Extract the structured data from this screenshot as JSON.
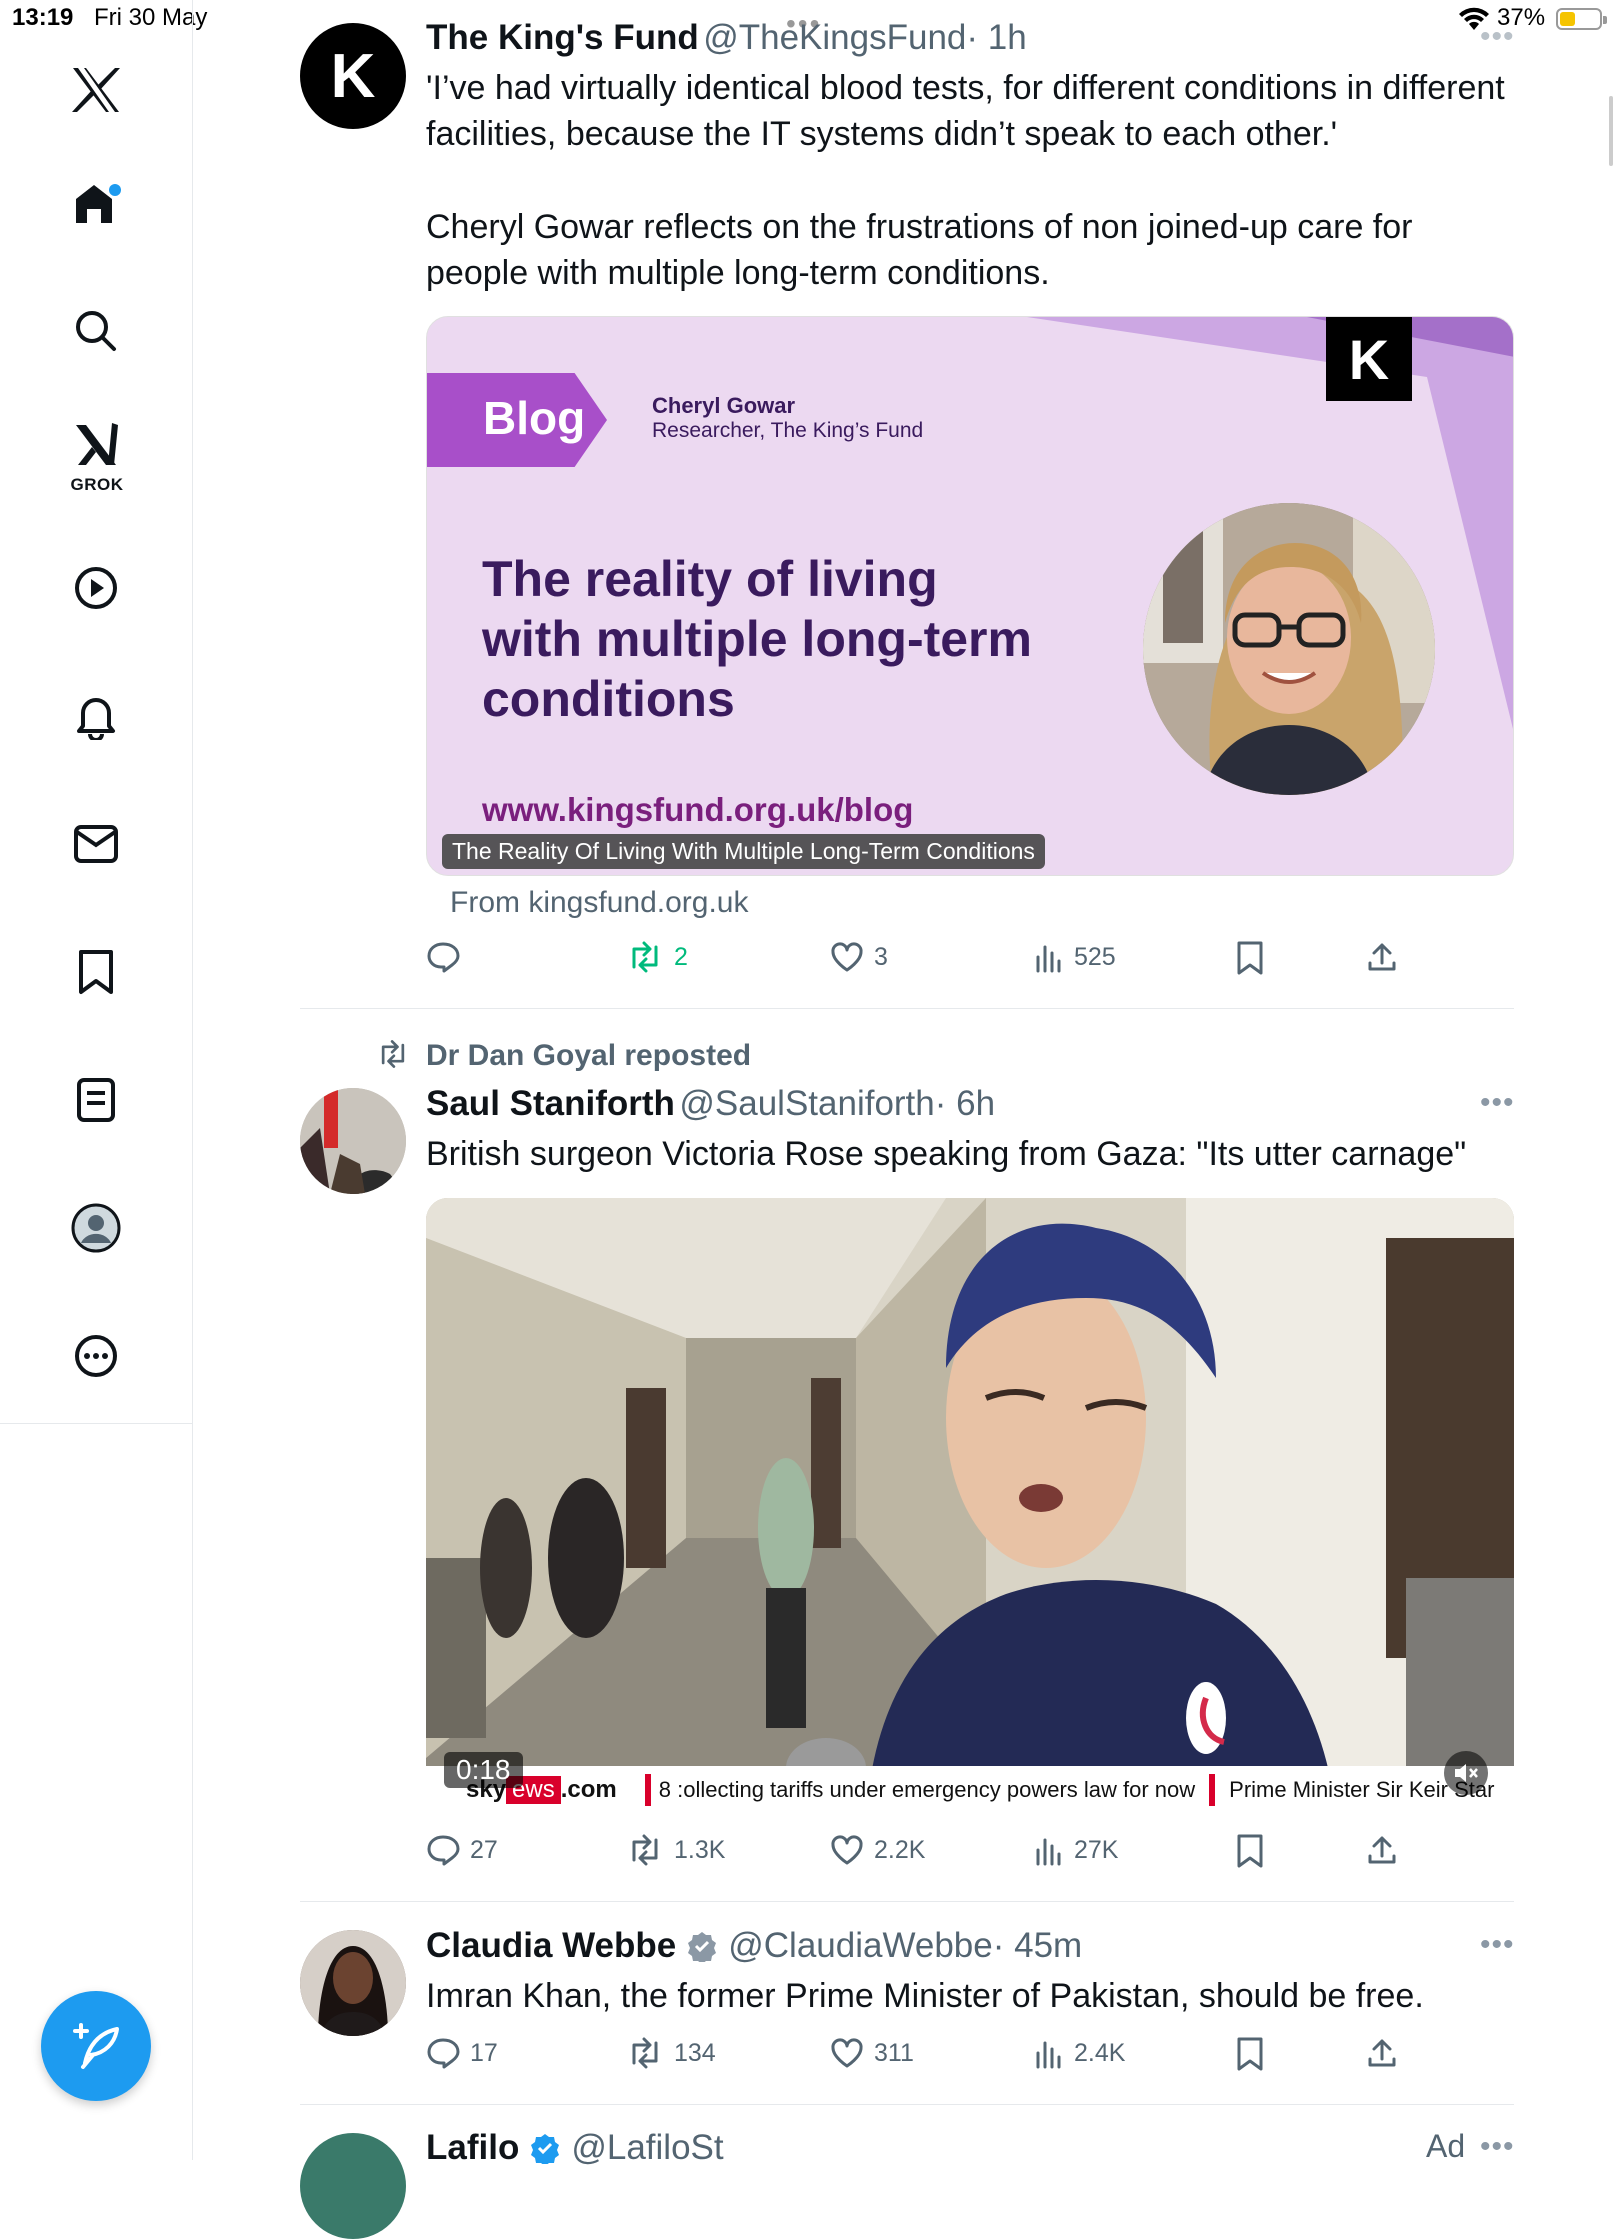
{
  "status_bar": {
    "time": "13:19",
    "date": "Fri 30 May",
    "battery": "37%"
  },
  "sidebar": {
    "grok_label": "GROK"
  },
  "tweets": [
    {
      "name": "The King's Fund",
      "handle": "@TheKingsFund",
      "time": "· 1h",
      "text1": "'I’ve had virtually identical blood tests, for different conditions in different facilities, because the IT systems didn’t speak to each other.'",
      "text2": "Cheryl Gowar reflects on the frustrations of non joined-up care for people with multiple long-term conditions.",
      "card": {
        "tag": "Blog",
        "author": "Cheryl Gowar",
        "author_role": "Researcher, The King’s Fund",
        "headline_1": "The reality of living",
        "headline_2": "with multiple long-term",
        "headline_3": "conditions",
        "url": "www.kingsfund.org.uk/blog",
        "logo": "K",
        "caption": "The Reality Of Living With Multiple Long-Term Conditions",
        "from": "From kingsfund.org.uk"
      },
      "stats": {
        "replies": "",
        "reposts": "2",
        "likes": "3",
        "views": "525"
      },
      "avatar_letter": "K"
    },
    {
      "repost_by": "Dr Dan Goyal reposted",
      "name": "Saul Staniforth",
      "handle": "@SaulStaniforth",
      "time": "· 6h",
      "text": "British surgeon Victoria Rose speaking from Gaza: \"Its utter carnage\"",
      "video": {
        "duration": "0:18",
        "ticker_brand": "sky",
        "ticker_news": "ews",
        "ticker_com": ".com",
        "ticker_text1": "8 :ollecting tariffs under emergency powers law for now",
        "ticker_text2": "Prime Minister Sir Keir Star"
      },
      "stats": {
        "replies": "27",
        "reposts": "1.3K",
        "likes": "2.2K",
        "views": "27K"
      }
    },
    {
      "name": "Claudia Webbe",
      "handle": "@ClaudiaWebbe",
      "time": "· 45m",
      "text": "Imran Khan, the former Prime Minister of Pakistan, should be free.",
      "stats": {
        "replies": "17",
        "reposts": "134",
        "likes": "311",
        "views": "2.4K"
      }
    },
    {
      "name": "Lafilo",
      "handle": "@LafiloSt",
      "ad": "Ad"
    }
  ],
  "colors": {
    "accent": "#1d9bf0",
    "repost_green": "#00ba7c",
    "card_bg": "#ecd9f1",
    "blog_purple": "#a84fc9",
    "headline": "#3a1b5e"
  }
}
